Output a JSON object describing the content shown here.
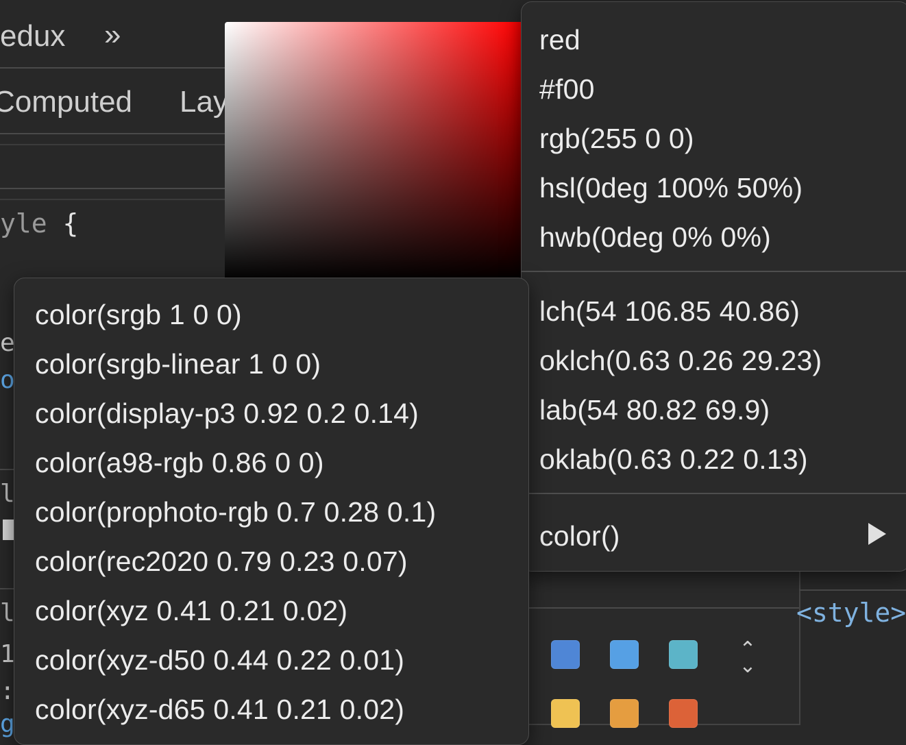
{
  "devtools": {
    "tab_redux": "edux",
    "more_tabs": "»",
    "tab_computed": "Computed",
    "tab_layout": "Lay",
    "code_selector": "yle",
    "code_brace": "{",
    "edge_chars": [
      "e",
      "o",
      "l",
      "1",
      "l",
      "1",
      ":",
      "g"
    ],
    "style_tag": "<style>"
  },
  "primary_menu": {
    "group1": [
      "red",
      "#f00",
      "rgb(255 0 0)",
      "hsl(0deg 100% 50%)",
      "hwb(0deg 0% 0%)"
    ],
    "group2": [
      "lch(54 106.85 40.86)",
      "oklch(0.63 0.26 29.23)",
      "lab(54 80.82 69.9)",
      "oklab(0.63 0.22 0.13)"
    ],
    "submenu_label": "color()"
  },
  "color_submenu": {
    "items": [
      "color(srgb 1 0 0)",
      "color(srgb-linear 1 0 0)",
      "color(display-p3 0.92 0.2 0.14)",
      "color(a98-rgb 0.86 0 0)",
      "color(prophoto-rgb 0.7 0.28 0.1)",
      "color(rec2020 0.79 0.23 0.07)",
      "color(xyz 0.41 0.21 0.02)",
      "color(xyz-d50 0.44 0.22 0.01)",
      "color(xyz-d65 0.41 0.21 0.02)"
    ]
  },
  "swatches": {
    "row1": [
      "#4f86d6",
      "#56a0e4",
      "#5cb4c8"
    ],
    "row2": [
      "#efc253",
      "#e59d40",
      "#dc6238"
    ],
    "stepper_up": "⌃",
    "stepper_down": "⌄"
  },
  "picker": {
    "hue": "#ff0000"
  }
}
